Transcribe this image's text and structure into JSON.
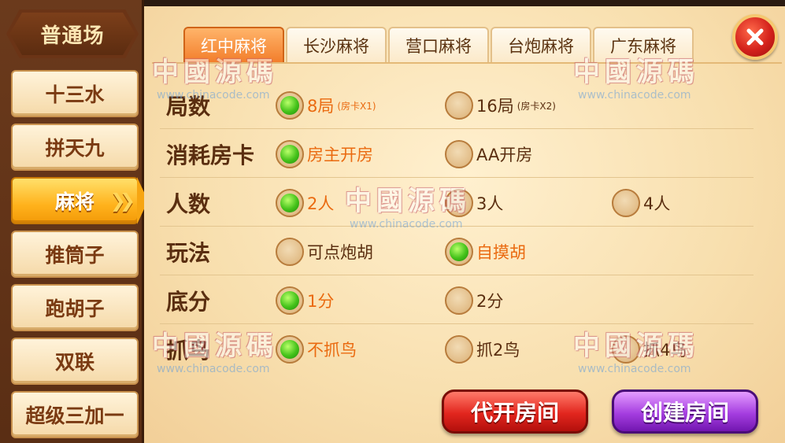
{
  "sidebar": {
    "title": "普通场",
    "items": [
      {
        "label": "十三水",
        "active": false
      },
      {
        "label": "拼天九",
        "active": false
      },
      {
        "label": "麻将",
        "active": true
      },
      {
        "label": "推筒子",
        "active": false
      },
      {
        "label": "跑胡子",
        "active": false
      },
      {
        "label": "双联",
        "active": false
      },
      {
        "label": "超级三加一",
        "active": false
      }
    ]
  },
  "tabs": [
    {
      "label": "红中麻将",
      "active": true
    },
    {
      "label": "长沙麻将",
      "active": false
    },
    {
      "label": "营口麻将",
      "active": false
    },
    {
      "label": "台炮麻将",
      "active": false
    },
    {
      "label": "广东麻将",
      "active": false
    }
  ],
  "rows": [
    {
      "label": "局数",
      "options": [
        {
          "text": "8局",
          "sub": "(房卡X1)",
          "selected": true
        },
        {
          "text": "16局",
          "sub": "(房卡X2)",
          "selected": false
        }
      ]
    },
    {
      "label": "消耗房卡",
      "options": [
        {
          "text": "房主开房",
          "selected": true
        },
        {
          "text": "AA开房",
          "selected": false
        }
      ]
    },
    {
      "label": "人数",
      "options": [
        {
          "text": "2人",
          "selected": true
        },
        {
          "text": "3人",
          "selected": false
        },
        {
          "text": "4人",
          "selected": false
        }
      ]
    },
    {
      "label": "玩法",
      "options": [
        {
          "text": "可点炮胡",
          "selected": false
        },
        {
          "text": "自摸胡",
          "selected": true
        }
      ]
    },
    {
      "label": "底分",
      "options": [
        {
          "text": "1分",
          "selected": true
        },
        {
          "text": "2分",
          "selected": false
        }
      ]
    },
    {
      "label": "抓鸟",
      "options": [
        {
          "text": "不抓鸟",
          "selected": true
        },
        {
          "text": "抓2鸟",
          "selected": false
        },
        {
          "text": "抓4鸟",
          "selected": false
        }
      ]
    }
  ],
  "buttons": {
    "proxy_open": "代开房间",
    "create_room": "创建房间"
  },
  "watermark": {
    "text": "中國源碼",
    "url": "www.chinacode.com"
  },
  "colors": {
    "selected_text": "#ea6a10",
    "label_text": "#5a2e10",
    "tab_active": "#f27d2a",
    "red_button": "#e2261e",
    "purple_button": "#a53ee0"
  }
}
